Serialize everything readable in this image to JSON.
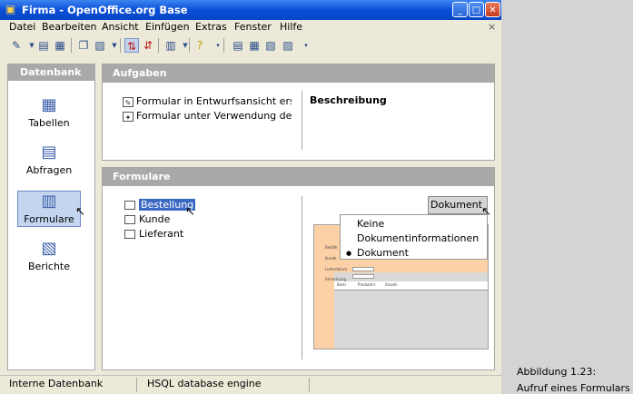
{
  "window": {
    "title": "Firma - OpenOffice.org Base",
    "controls": [
      "_",
      "□",
      "✕"
    ]
  },
  "menubar": {
    "items": [
      "Datei",
      "Bearbeiten",
      "Ansicht",
      "Einfügen",
      "Extras",
      "Fenster",
      "Hilfe"
    ],
    "close_glyph": "×"
  },
  "left_pane": {
    "header": "Datenbank",
    "items": [
      {
        "label": "Tabellen",
        "icon": "table-icon"
      },
      {
        "label": "Abfragen",
        "icon": "query-icon"
      },
      {
        "label": "Formulare",
        "icon": "form-icon",
        "selected": true
      },
      {
        "label": "Berichte",
        "icon": "report-icon"
      }
    ]
  },
  "tasks": {
    "header": "Aufgaben",
    "items": [
      "Formular in Entwurfsansicht erstellen...",
      "Formular unter Verwendung des Assistenten erstellen..."
    ],
    "description_title": "Beschreibung"
  },
  "forms": {
    "header": "Formulare",
    "items": [
      {
        "label": "Bestellung",
        "selected": true
      },
      {
        "label": "Kunde"
      },
      {
        "label": "Lieferant"
      }
    ],
    "preview_button": "Dokument",
    "preview_labels": [
      "BestNr",
      "Kunde",
      "Lieferdatum",
      "Anmerkung"
    ],
    "preview_columns": [
      "Bestr",
      "Produktnr",
      "Anzahl"
    ],
    "dropdown": {
      "items": [
        {
          "label": "Keine",
          "checked": false
        },
        {
          "label": "Dokumentinformationen",
          "checked": false
        },
        {
          "label": "Dokument",
          "checked": true
        }
      ],
      "bullet": "●"
    }
  },
  "statusbar": {
    "left": "Interne Datenbank",
    "right": "HSQL database engine"
  },
  "caption": {
    "line1": "Abbildung 1.23:",
    "line2": "Aufruf eines Formulars"
  }
}
